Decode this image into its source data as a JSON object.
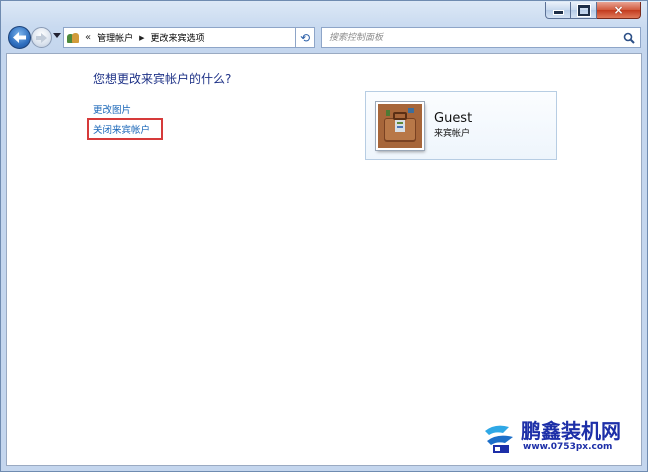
{
  "window": {
    "close_glyph": "×"
  },
  "nav": {
    "breadcrumb": [
      "管理帐户",
      "更改来宾选项"
    ],
    "chevron": "«",
    "separator": "▶",
    "refresh_glyph": "⟲",
    "search_placeholder": "搜索控制面板"
  },
  "main": {
    "question": "您想更改来宾帐户的什么?",
    "links": {
      "change_picture": "更改图片",
      "turn_off_guest": "关闭来宾帐户"
    },
    "highlight_color": "#d63a3a"
  },
  "account": {
    "name": "Guest",
    "type": "来宾帐户",
    "picture_icon": "briefcase-icon"
  },
  "watermark": {
    "title": "鹏鑫装机网",
    "url": "www.0753px.com"
  },
  "colors": {
    "link": "#1966b8",
    "heading": "#1e3287",
    "frame": "#c4d6ee"
  }
}
